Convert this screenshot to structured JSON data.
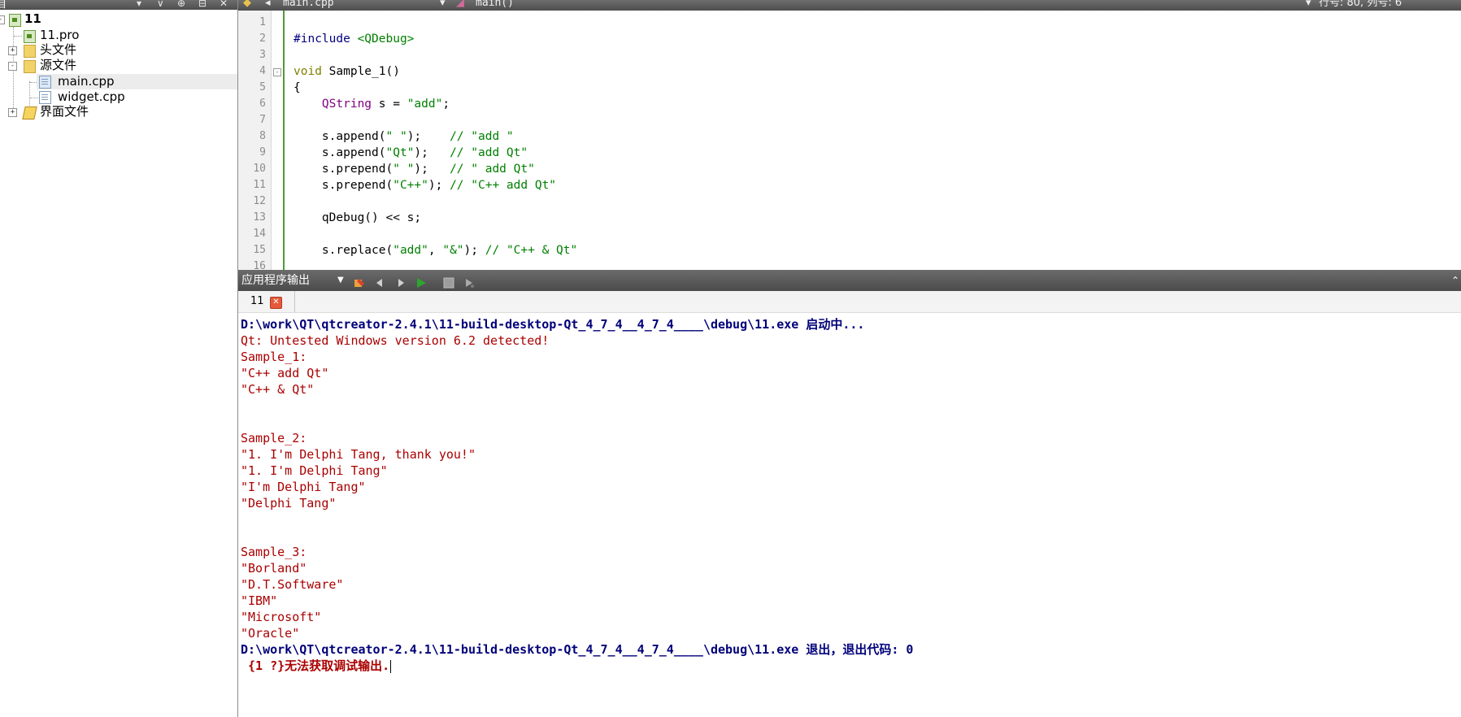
{
  "left_pane": {
    "title": "目",
    "tree": {
      "root": "11",
      "pro_file": "11.pro",
      "headers_folder": "头文件",
      "sources_folder": "源文件",
      "main_cpp": "main.cpp",
      "widget_cpp": "widget.cpp",
      "forms_folder": "界面文件"
    }
  },
  "editor_toolbar": {
    "file_name": "main.cpp",
    "function_name": "main()",
    "cursor_position": "行号: 80, 列号: 6"
  },
  "editor": {
    "line_numbers": [
      "1",
      "2",
      "3",
      "4",
      "5",
      "6",
      "7",
      "8",
      "9",
      "10",
      "11",
      "12",
      "13",
      "14",
      "15",
      "16"
    ],
    "lines": {
      "l2_pre": "#include ",
      "l2_hdr": "<QDebug>",
      "l4_kw": "void",
      "l4_rest": " Sample_1()",
      "l5": "{",
      "l6_indent": "    ",
      "l6_type": "QString",
      "l6_mid": " s = ",
      "l6_str": "\"add\"",
      "l6_end": ";",
      "l8_a": "    s.append(",
      "l8_str": "\" \"",
      "l8_b": ");    ",
      "l8_com": "// \"add \"",
      "l9_a": "    s.append(",
      "l9_str": "\"Qt\"",
      "l9_b": ");   ",
      "l9_com": "// \"add Qt\"",
      "l10_a": "    s.prepend(",
      "l10_str": "\" \"",
      "l10_b": ");   ",
      "l10_com": "// \" add Qt\"",
      "l11_a": "    s.prepend(",
      "l11_str": "\"C++\"",
      "l11_b": "); ",
      "l11_com": "// \"C++ add Qt\"",
      "l13": "    qDebug() << s;",
      "l15_a": "    s.replace(",
      "l15_str1": "\"add\"",
      "l15_b": ", ",
      "l15_str2": "\"&\"",
      "l15_c": "); ",
      "l15_com": "// \"C++ & Qt\""
    }
  },
  "output_pane": {
    "title": "应用程序输出",
    "tab_label": "11",
    "lines": [
      "D:\\work\\QT\\qtcreator-2.4.1\\11-build-desktop-Qt_4_7_4__4_7_4____\\debug\\11.exe 启动中...",
      "Qt: Untested Windows version 6.2 detected!",
      "Sample_1:",
      "\"C++ add Qt\"",
      "\"C++ & Qt\"",
      "Sample_2:",
      "\"1. I'm Delphi Tang, thank you!\"",
      "\"1. I'm Delphi Tang\"",
      "\"I'm Delphi Tang\"",
      "\"Delphi Tang\"",
      "Sample_3:",
      "\"Borland\"",
      "\"D.T.Software\"",
      "\"IBM\"",
      "\"Microsoft\"",
      "\"Oracle\"",
      "D:\\work\\QT\\qtcreator-2.4.1\\11-build-desktop-Qt_4_7_4__4_7_4____\\debug\\11.exe 退出，退出代码: 0",
      " {1 ?}无法获取调试输出."
    ]
  },
  "colors": {
    "output_red": "#aa0000",
    "output_blue": "#00007a",
    "toolbar_dark": "#555555",
    "run_green": "#2fa52f"
  }
}
